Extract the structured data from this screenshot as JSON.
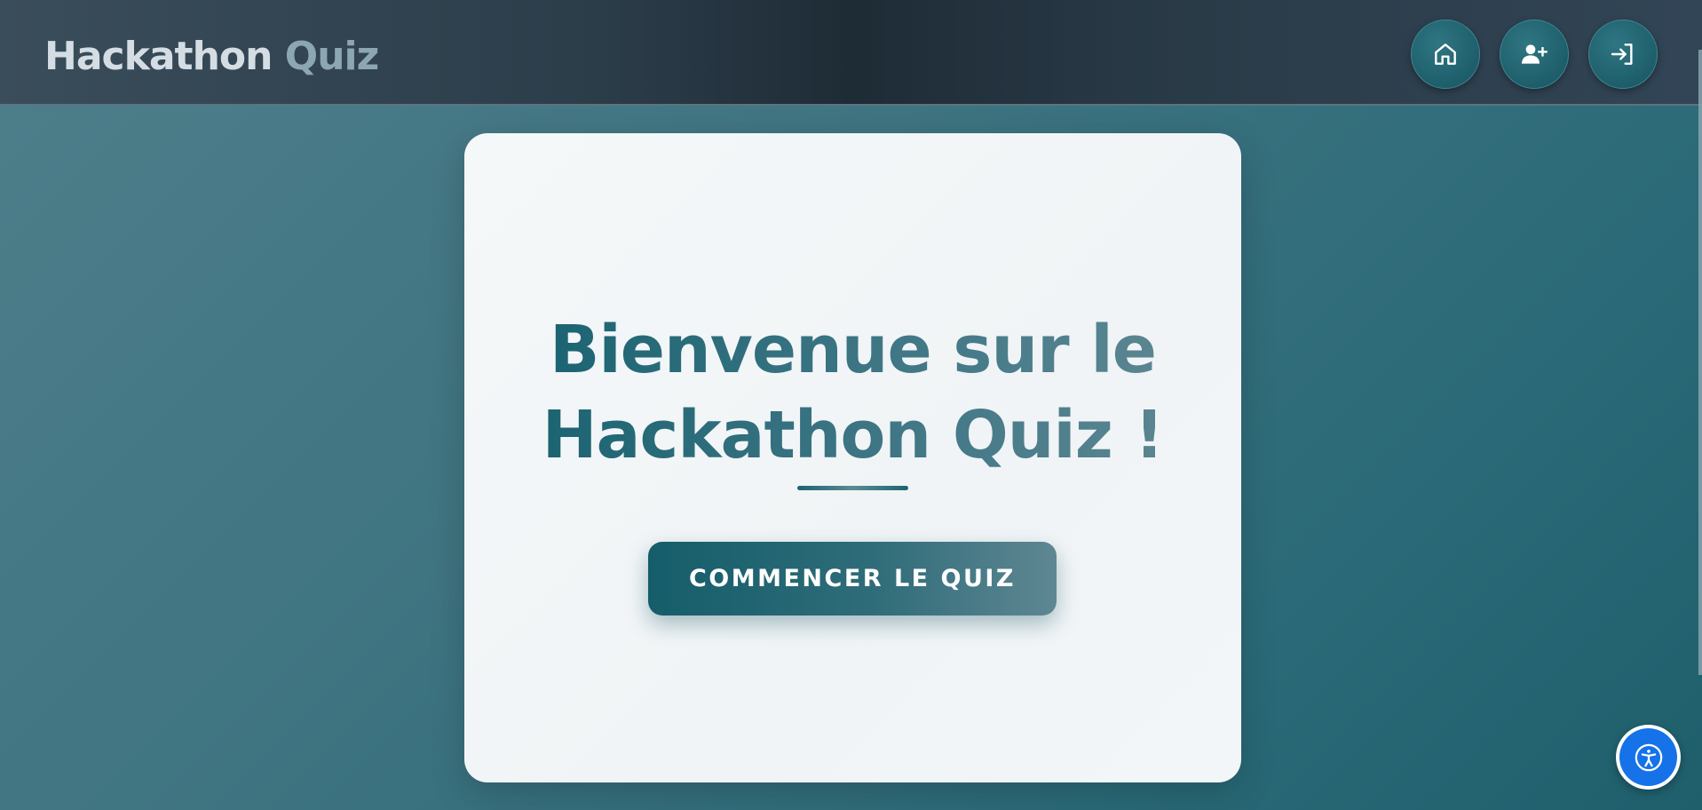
{
  "header": {
    "brand_word1": "Hackathon",
    "brand_word2": "Quiz",
    "nav": [
      {
        "icon": "home-icon",
        "label": ""
      },
      {
        "icon": "user-plus-icon",
        "label": ""
      },
      {
        "icon": "sign-in-icon",
        "label": ""
      }
    ]
  },
  "main": {
    "headline_line1": "Bienvenue sur le",
    "headline_line2": "Hackathon Quiz !",
    "cta_label": "COMMENCER LE QUIZ"
  },
  "accessibility": {
    "icon": "accessibility-icon"
  },
  "colors": {
    "header_bg": "#1e2c36",
    "page_bg": "#3f7481",
    "card_bg": "#f3f6f8",
    "accent": "#1c6472",
    "a11y_button": "#1572e8"
  }
}
